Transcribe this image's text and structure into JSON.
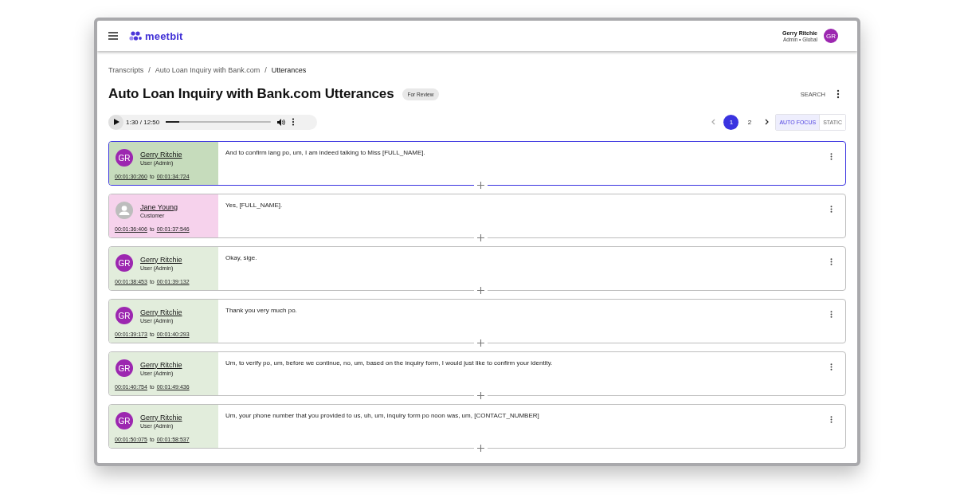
{
  "app": {
    "logo": "meetbit"
  },
  "user": {
    "name": "Gerry Ritchie",
    "role": "Admin • Global",
    "initials": "GR"
  },
  "breadcrumbs": [
    {
      "label": "Transcripts"
    },
    {
      "separator": "/",
      "label": "Auto Loan Inquiry with Bank.com"
    },
    {
      "separator": "/",
      "label": "Utterances"
    }
  ],
  "page": {
    "title": "Auto Loan Inquiry with Bank.com Utterances",
    "status": "For Review",
    "search": "SEARCH"
  },
  "player": {
    "time": "1:30 / 12:50",
    "level": 0.13
  },
  "pagination": {
    "pages": [
      {
        "label": "1",
        "selected": true
      },
      {
        "label": "2",
        "selected": false
      }
    ]
  },
  "modes": [
    {
      "label": "AUTO FOCUS",
      "selected": true
    },
    {
      "label": "STATIC",
      "selected": false
    }
  ],
  "utterances": [
    {
      "kind": "user",
      "selected": true,
      "speaker": "Gerry Ritchie",
      "initials": "GR",
      "role": "User (Admin)",
      "start": "00:01:30:260",
      "joiner": "to",
      "end": "00:01:34:724",
      "text": "And to confirm lang po, um, I am indeed talking to Miss [FULL_NAME]."
    },
    {
      "kind": "customer",
      "selected": false,
      "speaker": "Jane Young",
      "role": "Customer",
      "start": "00:01:36:406",
      "joiner": "to",
      "end": "00:01:37:546",
      "text": "Yes, [FULL_NAME]."
    },
    {
      "kind": "user",
      "selected": false,
      "speaker": "Gerry Ritchie",
      "initials": "GR",
      "role": "User (Admin)",
      "start": "00:01:38:453",
      "joiner": "to",
      "end": "00:01:39:132",
      "text": "Okay, sige."
    },
    {
      "kind": "user",
      "selected": false,
      "speaker": "Gerry Ritchie",
      "initials": "GR",
      "role": "User (Admin)",
      "start": "00:01:39:173",
      "joiner": "to",
      "end": "00:01:40:293",
      "text": "Thank you very much po."
    },
    {
      "kind": "user",
      "selected": false,
      "speaker": "Gerry Ritchie",
      "initials": "GR",
      "role": "User (Admin)",
      "start": "00:01:40:754",
      "joiner": "to",
      "end": "00:01:49:436",
      "text": "Um, to verify po, um, before we continue, no, um, based on the inquiry form, I would just like to confirm your identity."
    },
    {
      "kind": "user",
      "selected": false,
      "speaker": "Gerry Ritchie",
      "initials": "GR",
      "role": "User (Admin)",
      "start": "00:01:50:075",
      "joiner": "to",
      "end": "00:01:58:537",
      "text": "Um, your phone number that you provided to us, uh, um, inquiry form po noon was, um, [CONTACT_NUMBER]"
    }
  ]
}
